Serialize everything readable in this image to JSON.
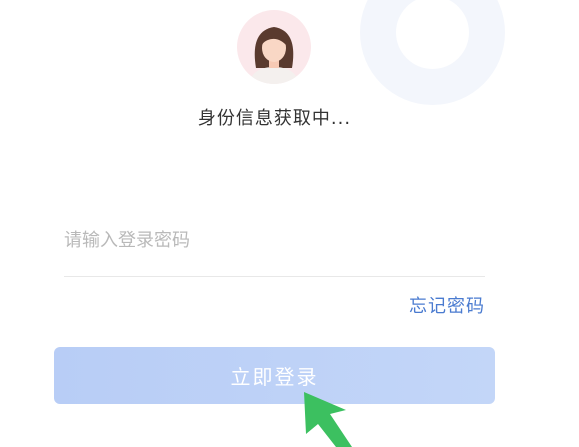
{
  "status": {
    "text": "身份信息获取中..."
  },
  "password": {
    "placeholder": "请输入登录密码",
    "value": ""
  },
  "forgot_password": {
    "label": "忘记密码"
  },
  "login_button": {
    "label": "立即登录"
  },
  "avatar": {
    "icon": "female-user-avatar-icon"
  },
  "cursor": {
    "icon": "green-arrow-pointer-icon"
  },
  "colors": {
    "link": "#4a7bd0",
    "button_bg": "#c3d6f8",
    "button_text": "#ffffff",
    "avatar_bg": "#fbe8eb",
    "cursor": "#3cc060"
  }
}
